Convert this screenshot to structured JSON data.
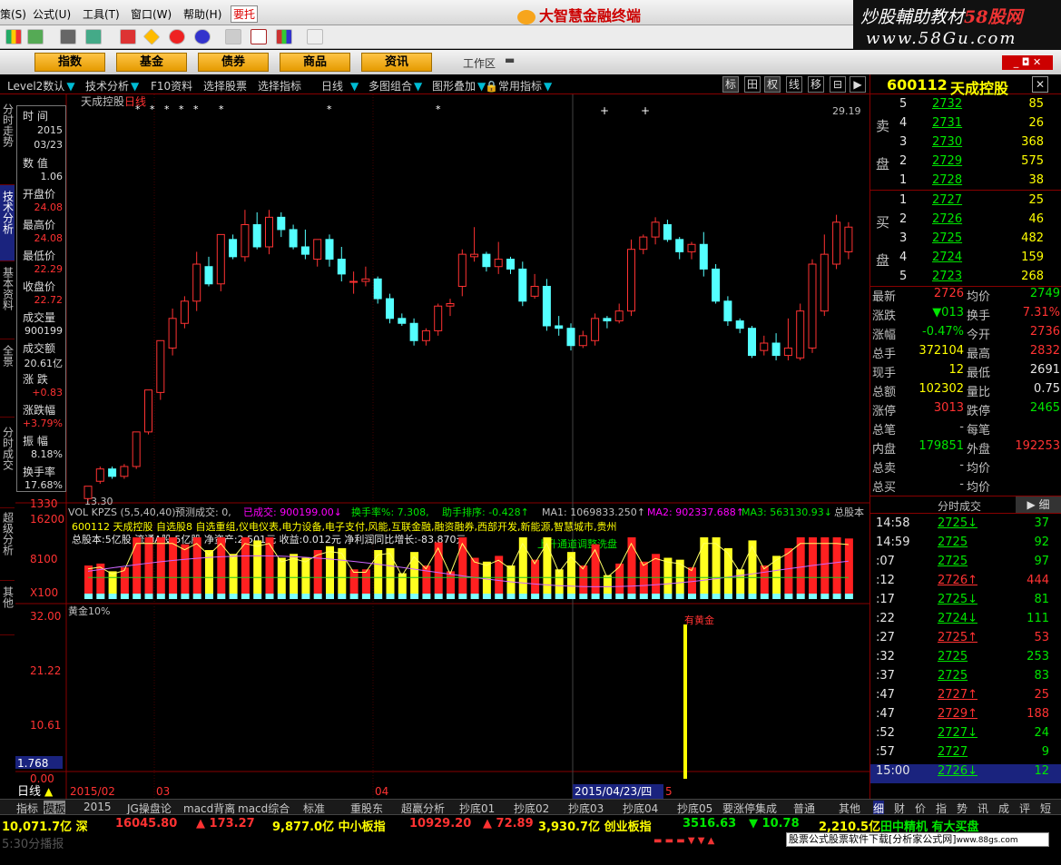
{
  "menu": {
    "items": [
      "策(S)",
      "公式(U)",
      "工具(T)",
      "窗口(W)",
      "帮助(H)"
    ],
    "highlight": "要托",
    "brand": "大智慧金融终端"
  },
  "watermark": {
    "line1a": "炒股輔助教材",
    "line1b": "58股网",
    "line2": "www.58Gu.com"
  },
  "nav": {
    "buttons": [
      "指数",
      "基金",
      "债券",
      "商品",
      "资讯"
    ],
    "workspace": "工作区"
  },
  "subbar": {
    "items": [
      "Level2数认",
      "技术分析",
      "F10资料",
      "选择股票",
      "选择指标",
      "日线",
      "多图组合",
      "图形叠加",
      "常用指标"
    ],
    "tools": [
      "标",
      "田",
      "权",
      "线",
      "移"
    ]
  },
  "left_tabs": [
    "分时走势",
    "技术分析",
    "基本资料",
    "全景",
    "分时成交",
    "超级分析",
    "其他"
  ],
  "info": {
    "time_label": "时 间",
    "year": "2015",
    "date": "03/23",
    "qty_label": "数 值",
    "qty": "1.06",
    "open_label": "开盘价",
    "open": "24.08",
    "high_label": "最高价",
    "high": "24.08",
    "low_label": "最低价",
    "low": "22.29",
    "close_label": "收盘价",
    "close": "22.72",
    "vol_label": "成交量",
    "vol": "900199",
    "amt_label": "成交额",
    "amt": "20.61亿",
    "chg_label": "涨 跌",
    "chg": "+0.83",
    "pct_label": "涨跌幅",
    "pct": "+3.79%",
    "amp_label": "振 幅",
    "amp": "8.18%",
    "turn_label": "换手率",
    "turn": "17.68%"
  },
  "chart": {
    "title": "天成控股",
    "period": "日线",
    "min_label": "13.30",
    "max_label": "29.19",
    "low_axis": "1330",
    "vol_header": {
      "label": "VOL KPZS (5,5,40,40)",
      "forecast": "预测成交: 0,",
      "done": "已成交: 900199.00↓",
      "turn": "换手率%: 7.308,",
      "rank": "助手排序: -0.428↑",
      "ma1": "MA1: 1069833.250↑",
      "ma2": "MA2: 902337.688↑",
      "ma3": "MA3: 563130.93↓",
      "share": "总股本"
    },
    "ann1": "600112 天成控股 自选股8 自选重组,仪电仪表,电力设备,电子支付,风能,互联金融,融资融券,西部开发,新能源,智慧城市,贵州",
    "ann2": "总股本:5亿股 流通A股:5亿股  净资产:2.501元  收益:0.012元  净利润同比增长:-83.870元",
    "ann3": "上升通道调整洗盘",
    "vol_axis": [
      "16200",
      "8100",
      "X100"
    ],
    "gold_title": "黄金10%",
    "gold_label": "有黄金",
    "gold_axis": [
      "32.00",
      "21.22",
      "10.61",
      "1.768",
      "0.00"
    ],
    "x_labels": [
      "2015/02",
      "03",
      "04",
      "2015/04/23/四",
      "5"
    ],
    "period_btn": "日线"
  },
  "chart_data": {
    "type": "candlestick",
    "x": [
      "2015-02-16",
      "2015-02-17",
      "2015-02-25",
      "2015-02-26",
      "2015-02-27",
      "2015-03-02",
      "2015-03-03",
      "2015-03-04",
      "2015-03-05",
      "2015-03-06",
      "2015-03-09",
      "2015-03-10",
      "2015-03-11",
      "2015-03-12",
      "2015-03-13",
      "2015-03-16",
      "2015-03-17",
      "2015-03-18",
      "2015-03-19",
      "2015-03-20",
      "2015-03-23",
      "2015-03-24",
      "2015-03-25",
      "2015-03-26",
      "2015-03-27",
      "2015-03-30",
      "2015-03-31",
      "2015-04-01",
      "2015-04-02",
      "2015-04-03",
      "2015-04-07",
      "2015-04-08",
      "2015-04-09",
      "2015-04-10",
      "2015-04-13",
      "2015-04-14",
      "2015-04-15",
      "2015-04-16",
      "2015-04-17",
      "2015-04-20",
      "2015-04-21",
      "2015-04-22",
      "2015-04-23",
      "2015-04-24",
      "2015-04-27",
      "2015-04-28",
      "2015-04-29",
      "2015-04-30",
      "2015-05-04",
      "2015-05-05",
      "2015-05-06",
      "2015-05-07",
      "2015-05-08",
      "2015-05-11",
      "2015-05-12",
      "2015-05-13",
      "2015-05-14",
      "2015-05-15",
      "2015-05-18",
      "2015-05-19",
      "2015-05-20",
      "2015-05-21",
      "2015-05-22",
      "2015-05-25"
    ],
    "open": [
      13.4,
      14.1,
      14.6,
      14.3,
      14.7,
      16.1,
      17.7,
      19.5,
      20.5,
      21.4,
      22.8,
      22.1,
      23.9,
      23.2,
      24.5,
      23.6,
      24.8,
      24.3,
      23.6,
      23.1,
      23.9,
      23.1,
      22.2,
      22.2,
      22.3,
      21.5,
      20.7,
      20.5,
      19.8,
      20.2,
      21.2,
      22.0,
      23.2,
      23.3,
      22.8,
      23.1,
      22.7,
      21.6,
      22.0,
      20.4,
      20.3,
      19.6,
      19.8,
      20.7,
      20.6,
      21.0,
      23.5,
      24.0,
      24.5,
      23.9,
      23.4,
      23.7,
      22.7,
      21.4,
      20.6,
      20.3,
      19.4,
      19.7,
      19.2,
      19.1,
      19.5,
      21.0,
      22.9,
      23.4
    ],
    "close": [
      13.9,
      14.6,
      14.3,
      14.7,
      16.1,
      17.8,
      19.8,
      20.7,
      21.4,
      22.9,
      22.1,
      24.1,
      23.2,
      24.5,
      23.6,
      24.8,
      24.3,
      23.6,
      23.3,
      23.9,
      23.1,
      22.5,
      22.2,
      22.3,
      21.5,
      20.7,
      20.5,
      19.8,
      20.2,
      21.2,
      21.3,
      23.3,
      23.3,
      22.8,
      23.1,
      22.7,
      21.4,
      22.0,
      20.4,
      20.3,
      19.6,
      20.0,
      20.7,
      20.6,
      21.0,
      23.5,
      24.0,
      24.6,
      23.9,
      23.4,
      23.7,
      22.7,
      21.4,
      20.6,
      20.3,
      19.2,
      19.7,
      19.2,
      19.5,
      21.0,
      22.9,
      23.3,
      24.6,
      24.4
    ],
    "high": [
      13.9,
      14.7,
      14.7,
      14.8,
      16.1,
      17.8,
      19.8,
      21.1,
      21.6,
      23.4,
      23.2,
      24.1,
      24.1,
      25.1,
      25.0,
      25.1,
      25.0,
      24.5,
      24.3,
      23.9,
      24.1,
      23.6,
      22.6,
      22.8,
      22.4,
      21.7,
      20.9,
      20.7,
      20.3,
      21.3,
      21.5,
      23.5,
      24.4,
      23.4,
      23.8,
      23.2,
      23.0,
      22.5,
      22.3,
      20.8,
      20.5,
      20.2,
      20.9,
      20.8,
      21.3,
      23.9,
      24.1,
      24.8,
      24.7,
      24.0,
      23.8,
      24.2,
      22.9,
      21.6,
      20.7,
      20.4,
      20.0,
      20.1,
      20.7,
      21.3,
      23.1,
      24.1,
      24.9,
      24.6
    ],
    "low": [
      13.3,
      14.0,
      14.2,
      14.2,
      14.6,
      16.0,
      17.4,
      19.2,
      20.3,
      21.0,
      22.0,
      21.8,
      23.1,
      23.0,
      23.5,
      23.3,
      24.0,
      23.5,
      23.1,
      22.8,
      22.8,
      22.2,
      21.7,
      22.0,
      21.3,
      20.5,
      20.4,
      19.6,
      19.6,
      20.0,
      20.8,
      21.6,
      23.0,
      22.6,
      22.5,
      22.5,
      21.2,
      21.5,
      20.2,
      20.0,
      19.4,
      19.5,
      19.6,
      20.3,
      20.5,
      20.8,
      23.3,
      23.7,
      23.8,
      23.1,
      23.1,
      22.4,
      21.3,
      20.4,
      20.1,
      19.1,
      19.2,
      19.0,
      19.0,
      19.0,
      19.3,
      20.8,
      22.7,
      23.1
    ],
    "ylim": [
      13.3,
      29.19
    ]
  },
  "quote": {
    "code": "600112",
    "name": "天成控股",
    "sell_label": [
      "卖",
      "盘"
    ],
    "buy_label": [
      "买",
      "盘"
    ],
    "sell": [
      {
        "n": "5",
        "p": "2732",
        "v": "85"
      },
      {
        "n": "4",
        "p": "2731",
        "v": "26"
      },
      {
        "n": "3",
        "p": "2730",
        "v": "368"
      },
      {
        "n": "2",
        "p": "2729",
        "v": "575"
      },
      {
        "n": "1",
        "p": "2728",
        "v": "38"
      }
    ],
    "buy": [
      {
        "n": "1",
        "p": "2727",
        "v": "25"
      },
      {
        "n": "2",
        "p": "2726",
        "v": "46"
      },
      {
        "n": "3",
        "p": "2725",
        "v": "482"
      },
      {
        "n": "4",
        "p": "2724",
        "v": "159"
      },
      {
        "n": "5",
        "p": "2723",
        "v": "268"
      }
    ],
    "stats": [
      [
        "最新",
        "2726",
        "均价",
        "2749"
      ],
      [
        "涨跌",
        "▼013",
        "换手",
        "7.31%"
      ],
      [
        "涨幅",
        "-0.47%",
        "今开",
        "2736"
      ],
      [
        "总手",
        "372104",
        "最高",
        "2832"
      ],
      [
        "现手",
        "12",
        "最低",
        "2691"
      ],
      [
        "总额",
        "102302",
        "量比",
        "0.75"
      ],
      [
        "涨停",
        "3013",
        "跌停",
        "2465"
      ],
      [
        "总笔",
        "-",
        "每笔",
        ""
      ],
      [
        "内盘",
        "179851",
        "外盘",
        "192253"
      ],
      [
        "总卖",
        "-",
        "均价",
        ""
      ],
      [
        "总买",
        "-",
        "均价",
        ""
      ]
    ],
    "ticks_title": "分时成交",
    "ticks_btn": "细",
    "ticks": [
      [
        "14:58",
        "2725↓",
        "37"
      ],
      [
        "14:59",
        "2725",
        "92"
      ],
      [
        ":07",
        "2725",
        "97"
      ],
      [
        ":12",
        "2726↑",
        "444"
      ],
      [
        ":17",
        "2725↓",
        "81"
      ],
      [
        ":22",
        "2724↓",
        "111"
      ],
      [
        ":27",
        "2725↑",
        "53"
      ],
      [
        ":32",
        "2725",
        "253"
      ],
      [
        ":37",
        "2725",
        "83"
      ],
      [
        ":47",
        "2727↑",
        "25"
      ],
      [
        ":47",
        "2729↑",
        "188"
      ],
      [
        ":52",
        "2727↓",
        "24"
      ],
      [
        ":57",
        "2727",
        "9"
      ],
      [
        "15:00",
        "2726↓",
        "12"
      ]
    ]
  },
  "bottom_tabs": [
    "指标",
    "模板",
    "2015",
    "JG操盘论",
    "macd背离",
    "macd综合",
    "标准",
    "重股东",
    "超赢分析",
    "抄底01",
    "抄底02",
    "抄底03",
    "抄底04",
    "抄底05",
    "要涨停集成",
    "普通",
    "其他"
  ],
  "right_tabs": [
    "细",
    "财",
    "价",
    "指",
    "势",
    "讯",
    "成",
    "评",
    "短"
  ],
  "status": {
    "a": "10,071.7亿 深",
    "b": "16045.80",
    "c": "▲ 173.27",
    "d": "9,877.0亿 中小板指",
    "e": "10929.20",
    "f": "▲ 72.89",
    "g": "3,930.7亿 创业板指",
    "h": "3516.63",
    "i": "▼ 10.78",
    "j": "2,210.5亿",
    "k": "田中精机 有大买盘"
  },
  "bottom": {
    "left": "5:30分播报",
    "ad": "股票公式股票软件下载[分析家公式网]",
    "ad_url": "www.88gs.com"
  }
}
